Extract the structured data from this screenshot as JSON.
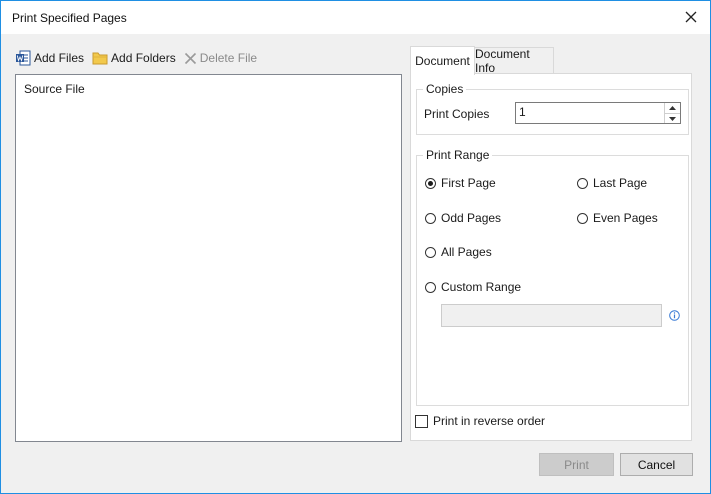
{
  "window": {
    "title": "Print Specified Pages"
  },
  "toolbar": {
    "add_files": "Add Files",
    "add_folders": "Add Folders",
    "delete_file": "Delete File"
  },
  "file_list": {
    "header": "Source File"
  },
  "tabs": [
    {
      "label": "Document",
      "active": true
    },
    {
      "label": "Document Info",
      "active": false
    }
  ],
  "copies": {
    "group_title": "Copies",
    "label": "Print Copies",
    "value": "1"
  },
  "print_range": {
    "group_title": "Print Range",
    "options": {
      "first_page": "First Page",
      "last_page": "Last Page",
      "odd_pages": "Odd Pages",
      "even_pages": "Even Pages",
      "all_pages": "All Pages",
      "custom_range": "Custom Range"
    },
    "selected": "first_page",
    "custom_value": ""
  },
  "reverse_order": {
    "label": "Print in reverse order",
    "checked": false
  },
  "buttons": {
    "print": "Print",
    "cancel": "Cancel"
  },
  "colors": {
    "accent_border": "#1f8fe3",
    "disabled_button": "#cccccc"
  }
}
